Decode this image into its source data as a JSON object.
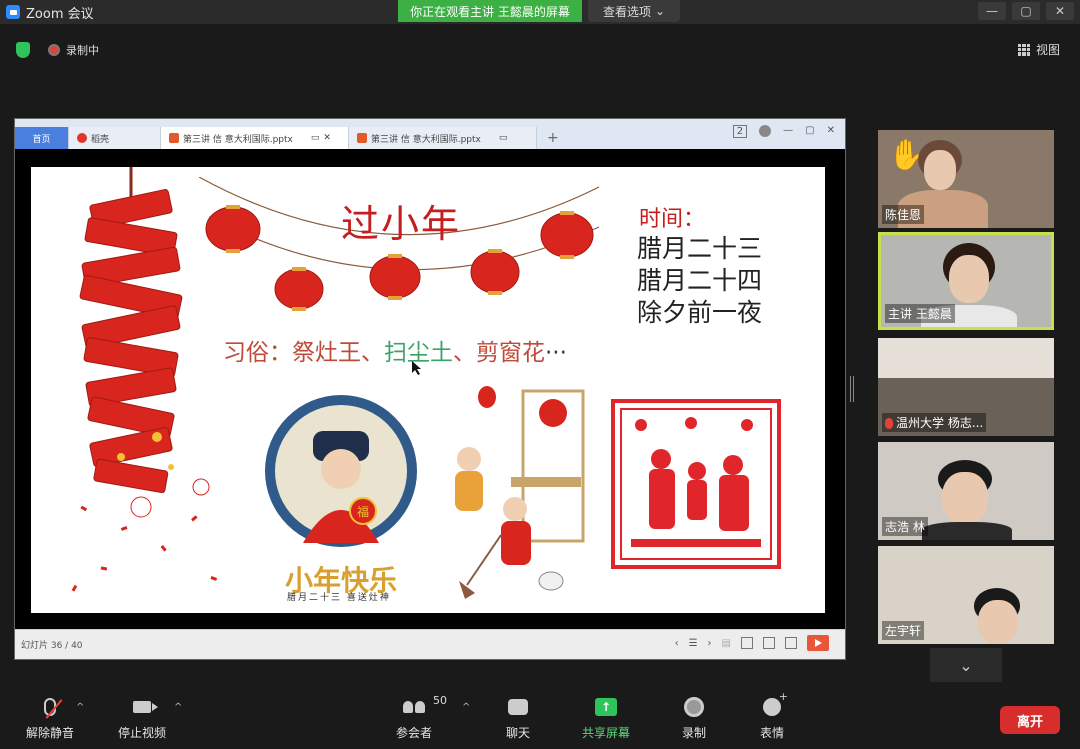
{
  "window": {
    "title": "Zoom 会议",
    "viewing_banner": "你正在观看主讲 王懿晨的屏幕",
    "view_options": "查看选项",
    "view_options_chevron": "chevron-down-icon"
  },
  "topbar": {
    "recording": "录制中",
    "view": "视图"
  },
  "ppt": {
    "tabs": [
      {
        "label": "首页"
      },
      {
        "label": "稻壳"
      },
      {
        "label": "第三讲 信 意大利国际.pptx"
      },
      {
        "label": "第三讲 信 意大利国际.pptx"
      }
    ],
    "slide_counter": "幻灯片 36 / 40",
    "tab_count": "2"
  },
  "slide": {
    "title": "过小年",
    "time_label": "时间：",
    "times": [
      "腊月二十三",
      "腊月二十四",
      "除夕前一夜"
    ],
    "customs_prefix": "习俗：",
    "custom_1": "祭灶王、",
    "custom_2": "扫尘土",
    "custom_sep": "、",
    "custom_3": "剪窗花",
    "custom_dots": "···",
    "happy": "小年快乐",
    "happy_sub": "腊月二十三 喜送灶神",
    "badge_char": "福"
  },
  "participants": [
    {
      "name": "陈佳恩"
    },
    {
      "name": "主讲 王懿晨"
    },
    {
      "name": "温州大学 杨志..."
    },
    {
      "name": "志浩 林"
    },
    {
      "name": "左宇轩"
    }
  ],
  "toolbar": {
    "unmute": "解除静音",
    "stop_video": "停止视频",
    "participants": "参会者",
    "participant_count": "50",
    "chat": "聊天",
    "share": "共享屏幕",
    "record": "录制",
    "reactions": "表情",
    "leave": "离开"
  },
  "colors": {
    "accent_green": "#3cb043",
    "active_tile_border": "#c7e14b",
    "leave_red": "#d72d2d",
    "slide_red": "#c41e1e"
  }
}
